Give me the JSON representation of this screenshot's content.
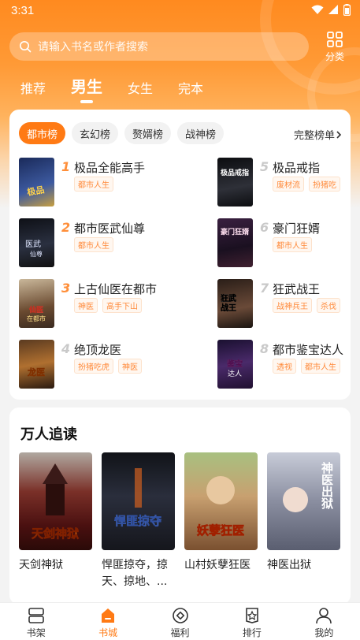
{
  "status": {
    "time": "3:31"
  },
  "search": {
    "placeholder": "请输入书名或作者搜索"
  },
  "category": {
    "label": "分类"
  },
  "gender_tabs": [
    {
      "label": "推荐"
    },
    {
      "label": "男生"
    },
    {
      "label": "女生"
    },
    {
      "label": "完本"
    }
  ],
  "rank": {
    "tabs": [
      {
        "label": "都市榜"
      },
      {
        "label": "玄幻榜"
      },
      {
        "label": "赘婿榜"
      },
      {
        "label": "战神榜"
      }
    ],
    "full_label": "完整榜单",
    "items": [
      {
        "num": "1",
        "title": "极品全能高手",
        "tags": [
          "都市人生"
        ],
        "cover": "#2b3b6e"
      },
      {
        "num": "2",
        "title": "都市医武仙尊",
        "tags": [
          "都市人生"
        ],
        "cover": "#1a1f2b"
      },
      {
        "num": "3",
        "title": "上古仙医在都市",
        "tags": [
          "神医",
          "高手下山"
        ],
        "cover": "#6a5a4a"
      },
      {
        "num": "4",
        "title": "绝顶龙医",
        "tags": [
          "扮猪吃虎",
          "神医"
        ],
        "cover": "#3a2a1a"
      },
      {
        "num": "5",
        "title": "极品戒指",
        "tags": [
          "废材流",
          "扮猪吃"
        ],
        "cover": "#1b1d22"
      },
      {
        "num": "6",
        "title": "豪门狂婿",
        "tags": [
          "都市人生"
        ],
        "cover": "#2a1a2e"
      },
      {
        "num": "7",
        "title": "狂武战王",
        "tags": [
          "战神兵王",
          "杀伐"
        ],
        "cover": "#3a2a22"
      },
      {
        "num": "8",
        "title": "都市鉴宝达人",
        "tags": [
          "透视",
          "都市人生"
        ],
        "cover": "#2a1d3a"
      }
    ]
  },
  "hot": {
    "title": "万人追读",
    "books": [
      {
        "title": "天剑神狱",
        "cover_text": "天剑神狱",
        "cover": "#6a1a14"
      },
      {
        "title": "悍匪掠夺，掠天、掠地、...",
        "cover_text": "悍匪掠夺",
        "cover": "#1f2230"
      },
      {
        "title": "山村妖孽狂医",
        "cover_text": "妖孽狂医",
        "cover": "#5b6a3a"
      },
      {
        "title": "神医出狱",
        "cover_text": "神医出狱",
        "cover": "#6b6e80"
      }
    ]
  },
  "nav": [
    {
      "label": "书架",
      "icon": "bookshelf-icon"
    },
    {
      "label": "书城",
      "icon": "bookstore-icon"
    },
    {
      "label": "福利",
      "icon": "welfare-icon"
    },
    {
      "label": "排行",
      "icon": "ranking-icon"
    },
    {
      "label": "我的",
      "icon": "profile-icon"
    }
  ],
  "colors": {
    "accent": "#ff7a14",
    "rank_top": "#ff8f3a",
    "rank_other": "#c9c9c9"
  }
}
